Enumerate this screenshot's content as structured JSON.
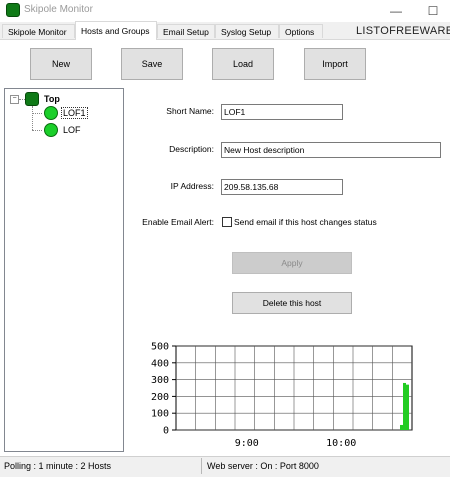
{
  "window": {
    "title": "Skipole Monitor",
    "minimize": "—",
    "maximize": "☐"
  },
  "tabs": [
    {
      "label": "Skipole Monitor"
    },
    {
      "label": "Hosts and Groups"
    },
    {
      "label": "Email Setup"
    },
    {
      "label": "Syslog Setup"
    },
    {
      "label": "Options"
    }
  ],
  "brand": "LISTOFREEWARE",
  "toolbar": {
    "new_label": "New",
    "save_label": "Save",
    "load_label": "Load",
    "import_label": "Import"
  },
  "tree": {
    "root": {
      "label": "Top",
      "expander": "−"
    },
    "children": [
      {
        "label": "LOF1",
        "selected": true
      },
      {
        "label": "LOF",
        "selected": false
      }
    ]
  },
  "form": {
    "short_name_label": "Short Name:",
    "short_name_value": "LOF1",
    "description_label": "Description:",
    "description_value": "New Host description",
    "ip_label": "IP Address:",
    "ip_value": "209.58.135.68",
    "email_alert_label": "Enable Email Alert:",
    "email_alert_text": "Send email if this host changes status",
    "email_alert_checked": false,
    "apply_label": "Apply",
    "delete_label": "Delete this host"
  },
  "chart_data": {
    "type": "bar",
    "ylim": [
      0,
      500
    ],
    "yticks": [
      "500",
      "400",
      "300",
      "200",
      "100",
      "0"
    ],
    "xticks": [
      "9:00",
      "10:00"
    ],
    "series": [
      {
        "values": [
          30,
          280,
          270
        ],
        "color": "#22cc22"
      }
    ]
  },
  "status": {
    "left": "Polling : 1 minute : 2 Hosts",
    "right": "Web server : On : Port 8000"
  }
}
